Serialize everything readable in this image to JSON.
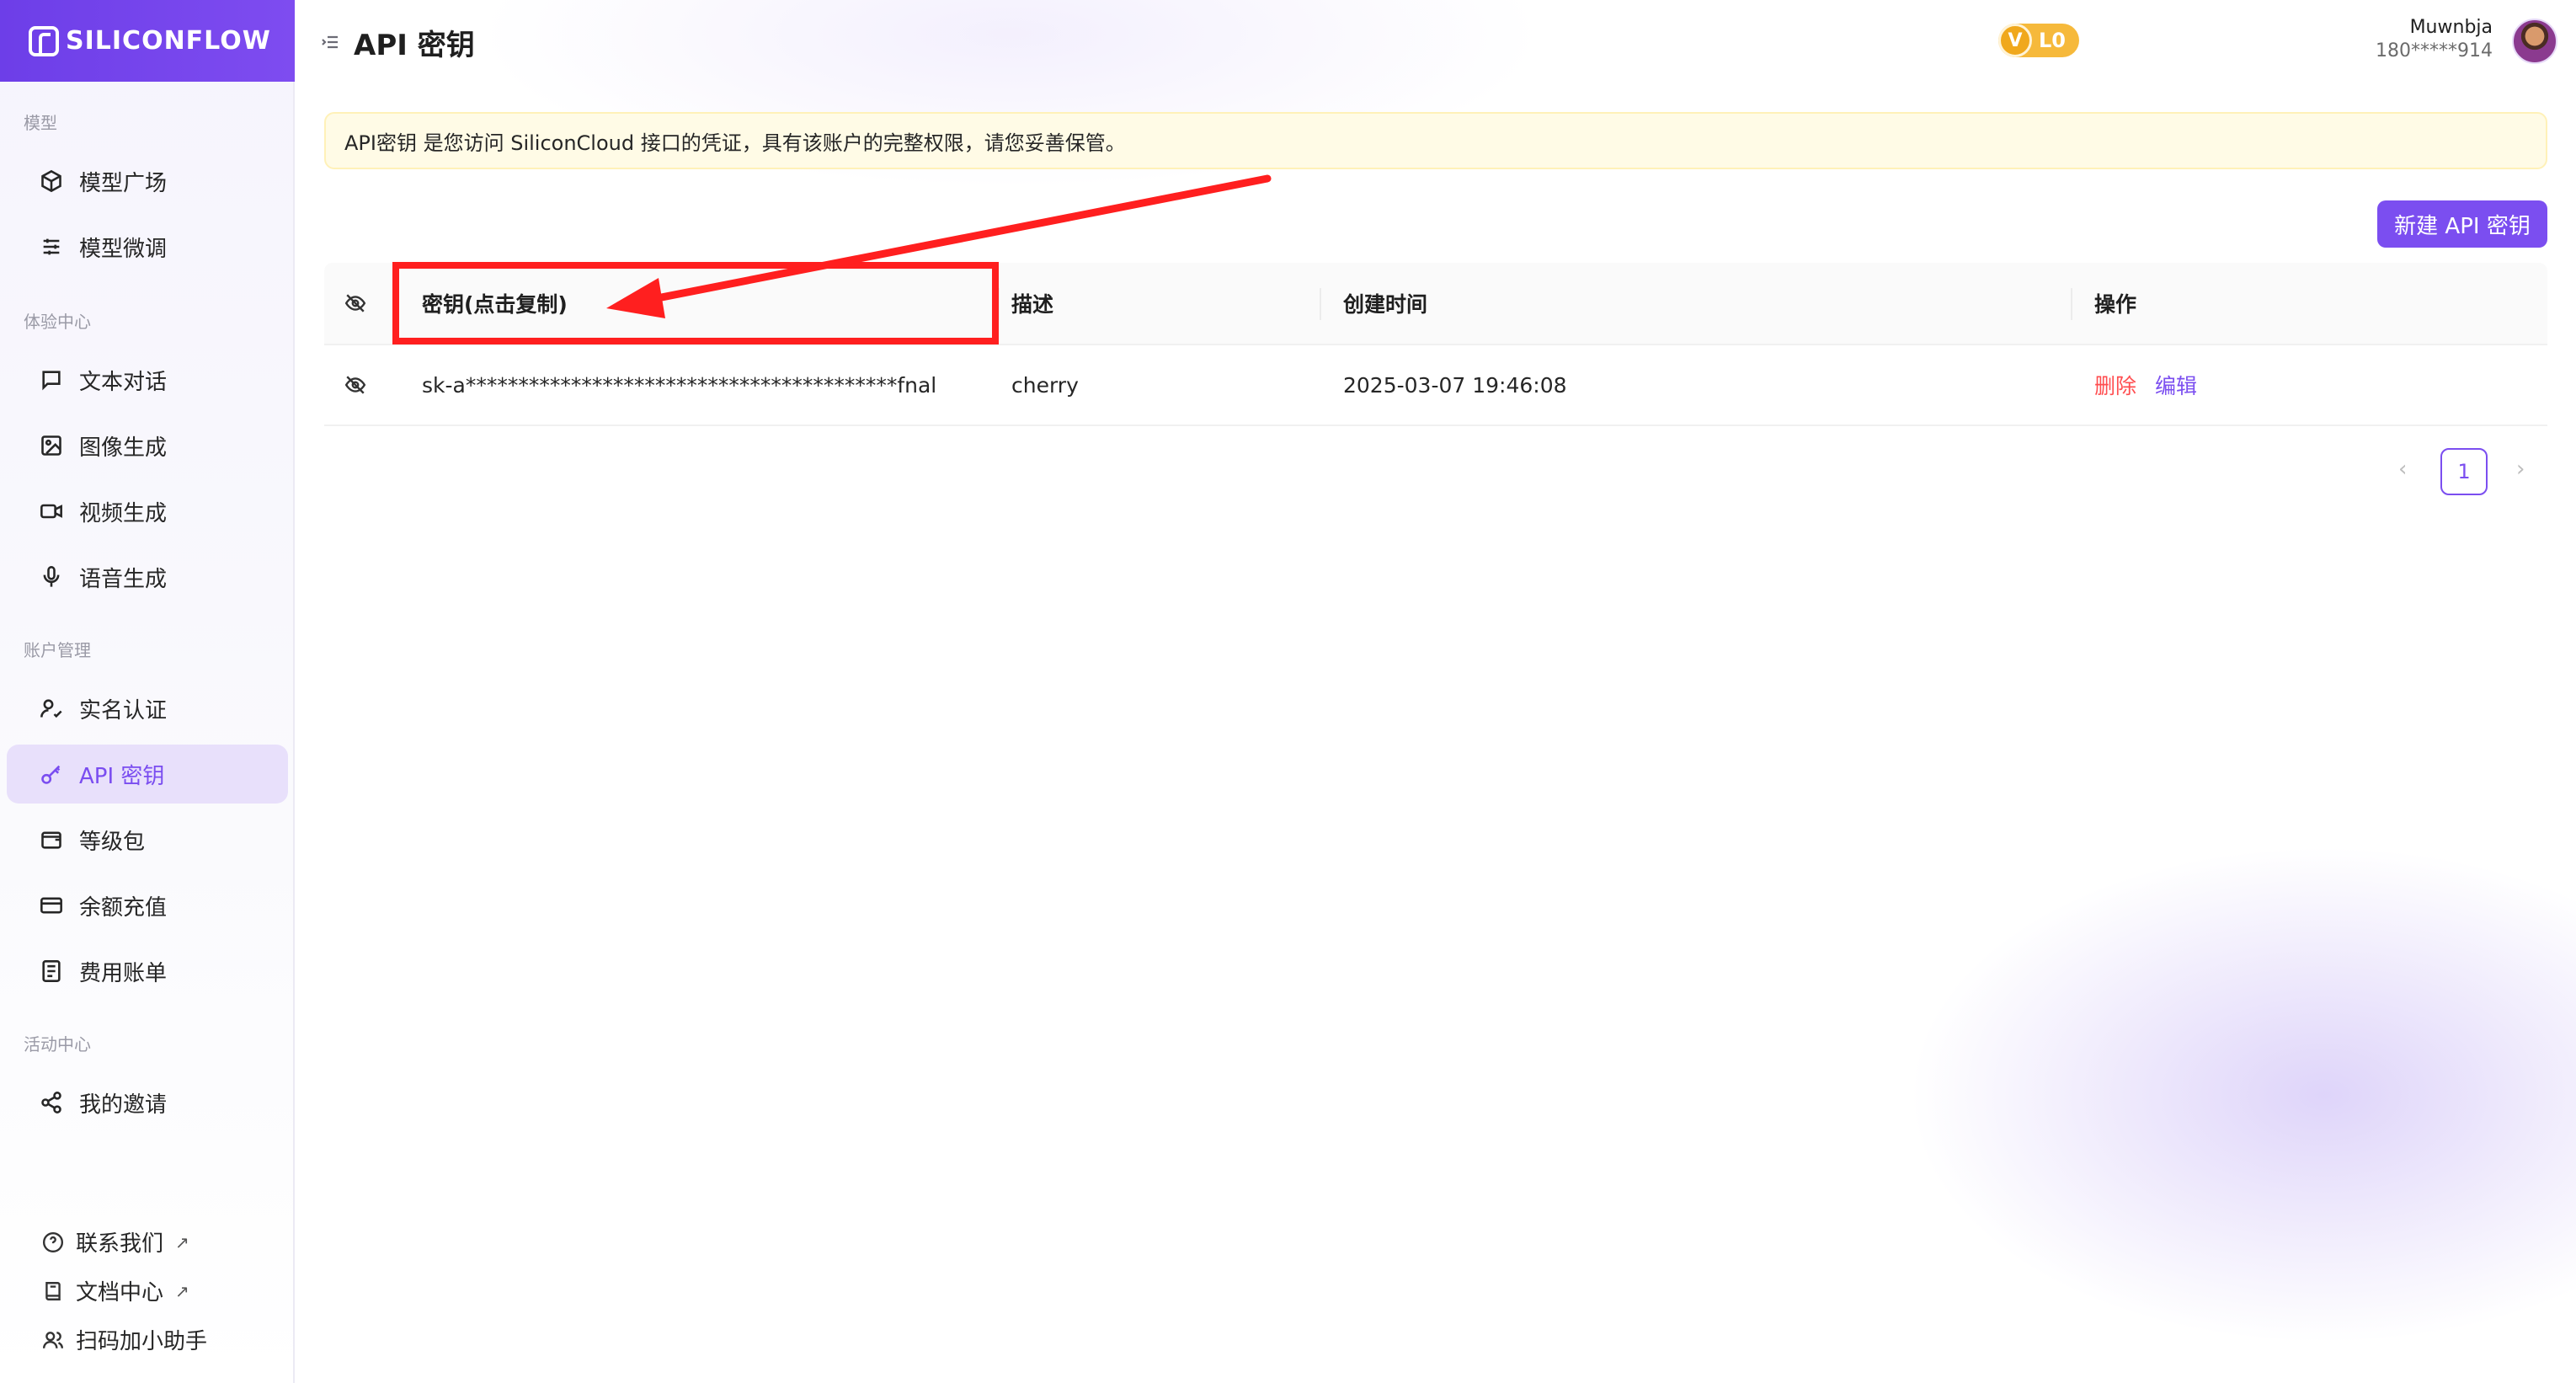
{
  "app": {
    "logo_text": "SILICONFLOW",
    "brand_color": "#7b4ef0"
  },
  "header": {
    "title": "API 密钥",
    "level_badge": "L0",
    "level_v": "V",
    "user_name": "Muwnbja",
    "user_phone": "180*****914"
  },
  "sidebar": {
    "sections": [
      {
        "label": "模型"
      },
      {
        "label": "体验中心"
      },
      {
        "label": "账户管理"
      },
      {
        "label": "活动中心"
      }
    ],
    "items": [
      {
        "label": "模型广场",
        "icon": "cube-icon"
      },
      {
        "label": "模型微调",
        "icon": "sliders-icon"
      },
      {
        "label": "文本对话",
        "icon": "chat-icon"
      },
      {
        "label": "图像生成",
        "icon": "image-icon"
      },
      {
        "label": "视频生成",
        "icon": "video-icon"
      },
      {
        "label": "语音生成",
        "icon": "mic-icon"
      },
      {
        "label": "实名认证",
        "icon": "user-check-icon"
      },
      {
        "label": "API 密钥",
        "icon": "key-icon",
        "active": true
      },
      {
        "label": "等级包",
        "icon": "wallet-icon"
      },
      {
        "label": "余额充值",
        "icon": "card-icon"
      },
      {
        "label": "费用账单",
        "icon": "bill-icon"
      },
      {
        "label": "我的邀请",
        "icon": "share-icon"
      }
    ],
    "footer": [
      {
        "label": "联系我们",
        "icon": "help-icon",
        "external": "↗"
      },
      {
        "label": "文档中心",
        "icon": "book-icon",
        "external": "↗"
      },
      {
        "label": "扫码加小助手",
        "icon": "users-icon",
        "external": ""
      }
    ]
  },
  "notice": {
    "text": "API密钥 是您访问 SiliconCloud 接口的凭证，具有该账户的完整权限，请您妥善保管。"
  },
  "toolbar": {
    "new_key_label": "新建 API 密钥"
  },
  "table": {
    "headers": {
      "key": "密钥(点击复制)",
      "description": "描述",
      "created": "创建时间",
      "actions": "操作"
    },
    "rows": [
      {
        "key": "sk-a*****************************************fnal",
        "description": "cherry",
        "created": "2025-03-07 19:46:08",
        "delete_label": "删除",
        "edit_label": "编辑"
      }
    ]
  },
  "pagination": {
    "prev": "‹",
    "current": "1",
    "next": "›"
  },
  "annotation": {
    "color": "#ff1f1f"
  }
}
